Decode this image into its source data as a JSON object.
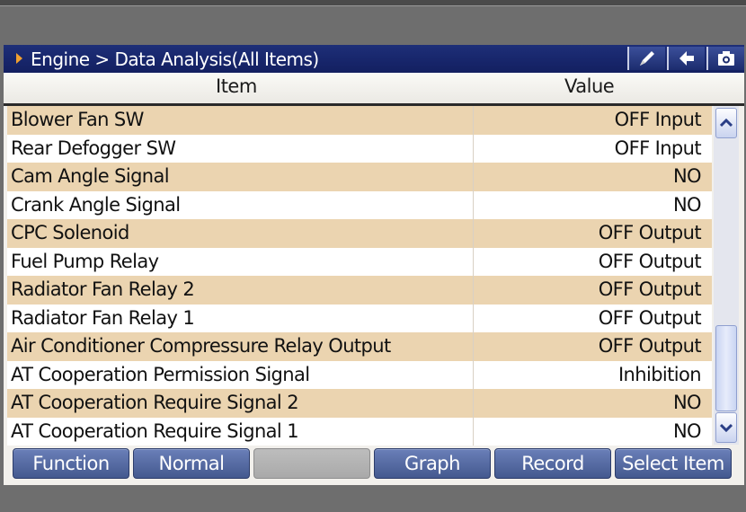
{
  "header": {
    "title": "Engine > Data Analysis(All Items)",
    "icons": [
      "pen-icon",
      "back-arrow-icon",
      "camera-icon"
    ]
  },
  "columns": {
    "item": "Item",
    "value": "Value"
  },
  "rows": [
    {
      "name": "Blower Fan SW",
      "value": "OFF Input"
    },
    {
      "name": "Rear Defogger SW",
      "value": "OFF Input"
    },
    {
      "name": "Cam Angle Signal",
      "value": "NO"
    },
    {
      "name": "Crank Angle Signal",
      "value": "NO"
    },
    {
      "name": "CPC Solenoid",
      "value": "OFF Output"
    },
    {
      "name": "Fuel Pump Relay",
      "value": "OFF Output"
    },
    {
      "name": "Radiator Fan Relay 2",
      "value": "OFF Output"
    },
    {
      "name": "Radiator Fan Relay 1",
      "value": "OFF Output"
    },
    {
      "name": "Air Conditioner Compressure Relay Output",
      "value": "OFF Output"
    },
    {
      "name": "AT Cooperation Permission Signal",
      "value": "Inhibition"
    },
    {
      "name": "AT Cooperation Require Signal 2",
      "value": "NO"
    },
    {
      "name": "AT Cooperation Require Signal 1",
      "value": "NO"
    }
  ],
  "toolbar": {
    "function": "Function",
    "normal": "Normal",
    "empty": "",
    "graph": "Graph",
    "record": "Record",
    "select_item": "Select Item"
  },
  "colors": {
    "title_bar": "#17256a",
    "row_alt": "#ebd4b0",
    "button": "#5a6ea6",
    "accent_arrow": "#f0a030"
  }
}
